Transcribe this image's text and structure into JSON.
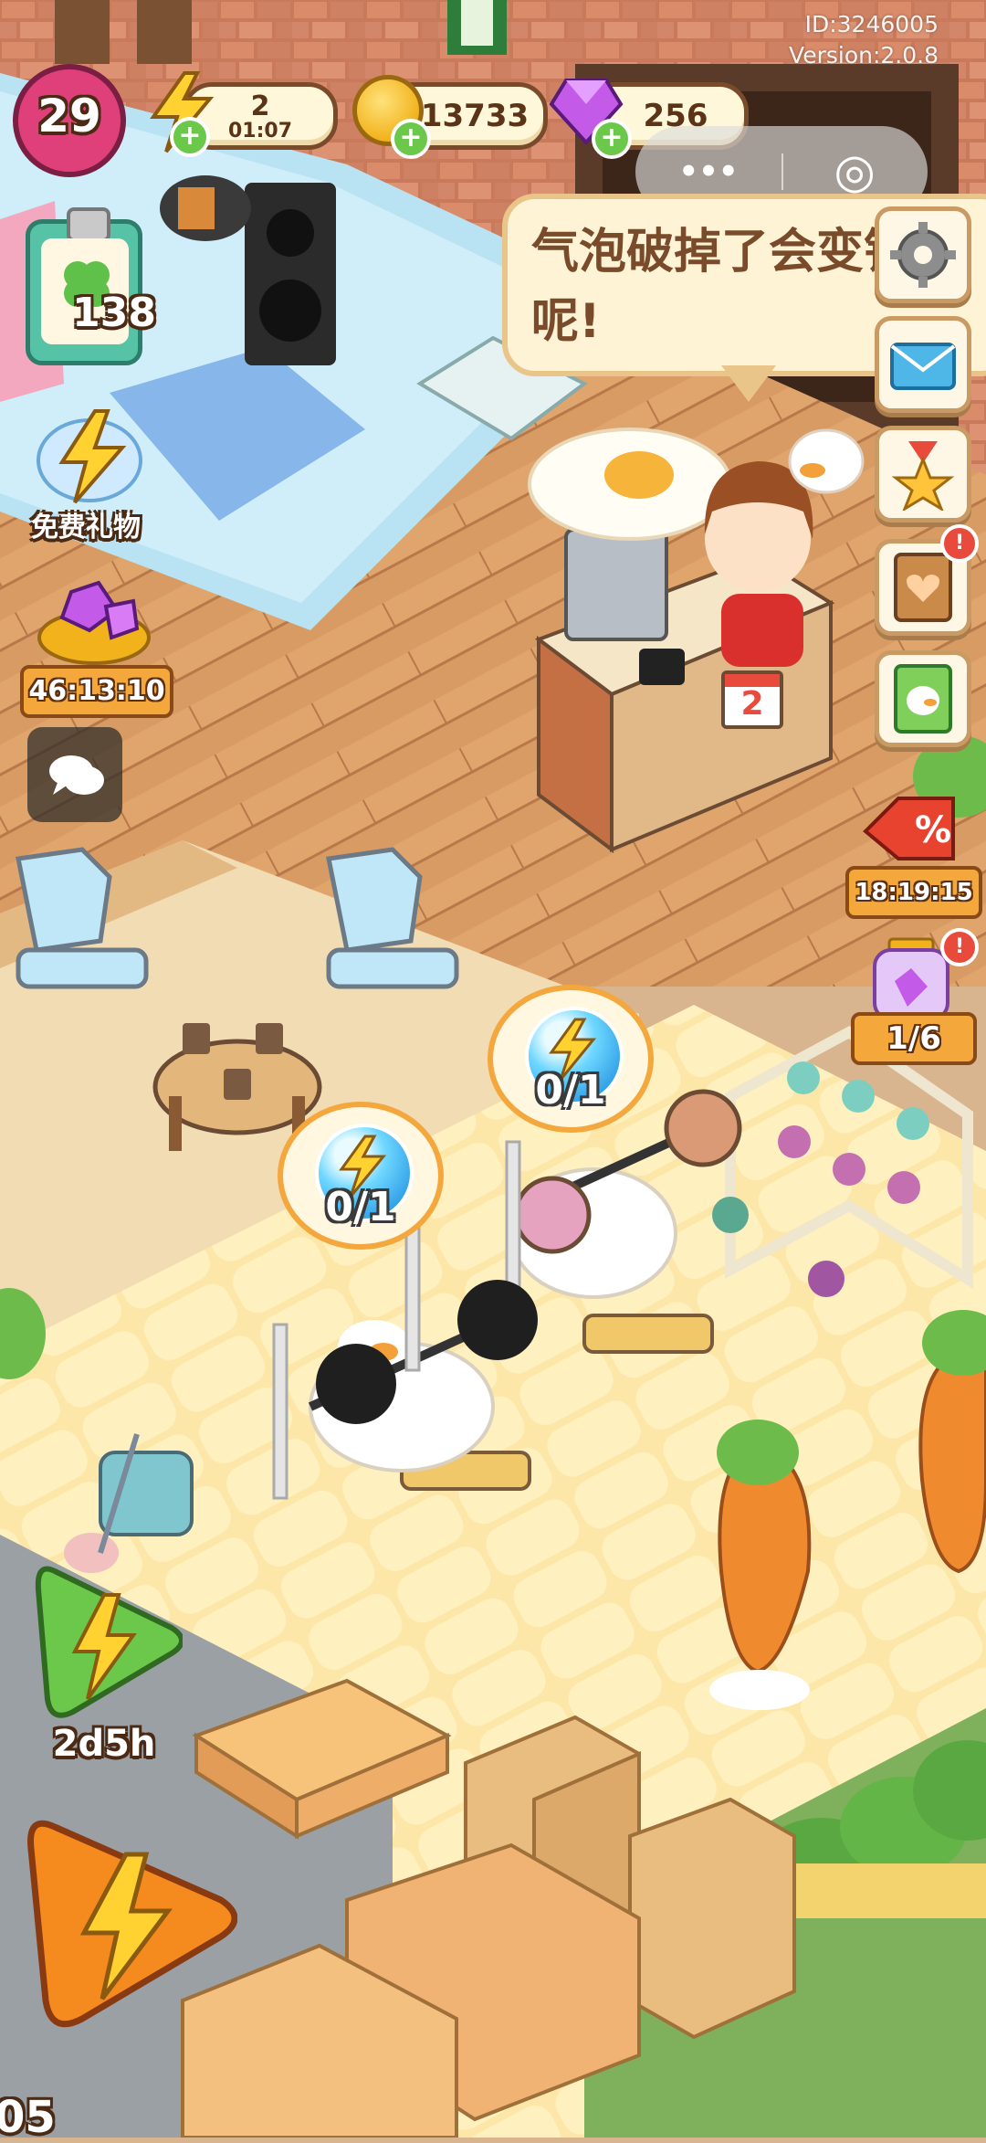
{
  "build": {
    "id": "ID:3246005",
    "version": "Version:2.0.8"
  },
  "hud": {
    "level": "29",
    "energy": {
      "value": "2",
      "timer": "01:07"
    },
    "coins": {
      "value": "13733"
    },
    "gems": {
      "value": "256"
    }
  },
  "mini_program": {
    "more_glyph": "•••",
    "close_glyph": "◎"
  },
  "left_panel": {
    "clipboard_count": "138",
    "free_gift_label": "免费礼物",
    "gem_offer_timer": "46:13:10"
  },
  "speech_bubble": {
    "text": "气泡破掉了会变钱呢!"
  },
  "right_panel": {
    "sale_timer": "18:19:15",
    "jar_progress": "1/6"
  },
  "desk": {
    "calendar_day": "2"
  },
  "bubbles": [
    {
      "count": "0/1"
    },
    {
      "count": "0/1"
    }
  ],
  "bottom": {
    "green_boost_timer": "2d5h",
    "orange_corner_text": "05"
  },
  "colors": {
    "accent_orange": "#f3a73c",
    "level_pink": "#e0407a",
    "gem_purple": "#b03fd8",
    "boost_green": "#6cc84a"
  }
}
